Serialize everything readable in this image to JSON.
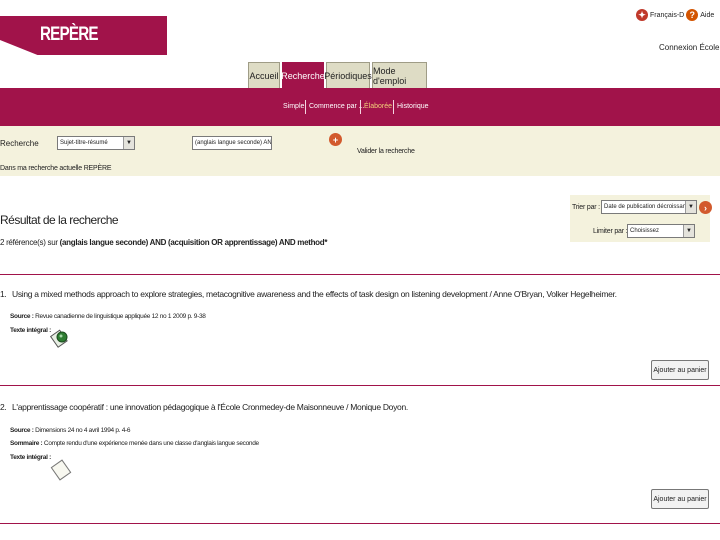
{
  "header": {
    "logo_text": "REPÈRE",
    "links": {
      "languages": "Français-D",
      "help": "Aide",
      "login": "Connexion École"
    }
  },
  "tabs": [
    {
      "label": "Accueil"
    },
    {
      "label": "Recherche"
    },
    {
      "label": "Périodiques"
    },
    {
      "label": "Mode d'emploi"
    }
  ],
  "subnav": {
    "items": [
      "Simple",
      "Commence par ...",
      "Élaborée",
      "Historique"
    ],
    "current": "Élaborée"
  },
  "search": {
    "field_label": "Recherche",
    "field_select": "Sujet-titre-résumé",
    "query": "(anglais langue seconde) AN",
    "validate": "Valider la recherche",
    "scope_text": "Dans ma recherche actuelle REPÈRE"
  },
  "results_header": {
    "title": "Résultat de la recherche",
    "summary_prefix": "2 référence(s) sur",
    "summary_query": "(anglais langue seconde) AND (acquisition OR apprentissage) AND method*"
  },
  "sort": {
    "sort_label": "Trier par :",
    "sort_value": "Date de publication décroissante",
    "limit_label": "Limiter par :",
    "limit_value": "Choisissez"
  },
  "results": [
    {
      "number": "1.",
      "title": "Using a mixed methods approach to explore strategies, metacognitive awareness and the effects of task design on listening development / Anne O'Bryan, Volker Hegelheimer.",
      "source_label": "Source :",
      "source": "Revue canadienne de linguistique appliquée 12 no 1 2009 p. 9-38",
      "fulltext_label": "Texte intégral :",
      "button": "Ajouter au panier"
    },
    {
      "number": "2.",
      "title": "L'apprentissage coopératif : une innovation pédagogique à l'École Cronmedey-de Maisonneuve / Monique Doyon.",
      "source_label": "Source :",
      "source": "Dimensions 24 no 4 avril 1994 p. 4-6",
      "summary_label": "Sommaire :",
      "summary": "Compte rendu d'une expérience menée dans une classe d'anglais langue seconde",
      "fulltext_label": "Texte intégral :",
      "button": "Ajouter au panier"
    }
  ],
  "colors": {
    "brand": "#a1134a",
    "band": "#f4f2dd",
    "current_subnav": "#f3d17a",
    "go_button": "#d25a2d"
  },
  "icons": [
    "languages-icon",
    "help-icon",
    "add-criterion-icon",
    "sort-go-icon",
    "full-text-icon",
    "document-icon"
  ]
}
